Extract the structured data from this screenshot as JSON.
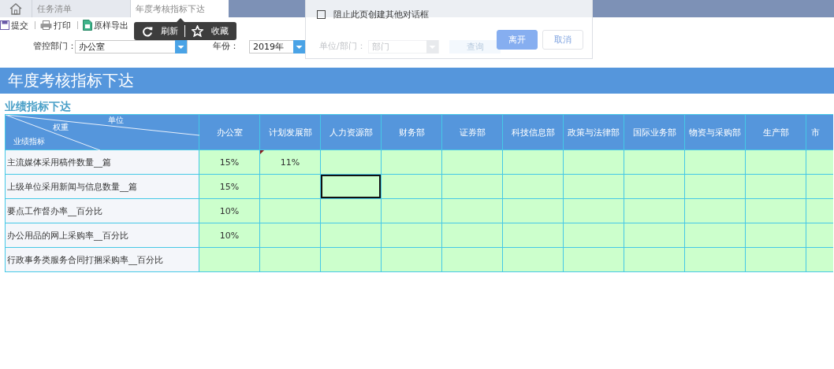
{
  "tabs": [
    {
      "kind": "home",
      "selected": false
    },
    {
      "kind": "text",
      "label": "任务清单",
      "selected": false
    },
    {
      "kind": "text",
      "label": "年度考核指标下达",
      "selected": true
    }
  ],
  "toolbar": [
    {
      "kind": "save",
      "label": "提交"
    },
    {
      "kind": "print",
      "label": "打印"
    },
    {
      "kind": "export",
      "label": "原样导出"
    }
  ],
  "popup": [
    {
      "kind": "refresh",
      "label": "刷新"
    },
    {
      "kind": "star",
      "label": "收藏"
    }
  ],
  "filters": [
    {
      "kind": "select",
      "label": "管控部门：",
      "value": "办公室",
      "disabled": false
    },
    {
      "kind": "select",
      "label": "年份：",
      "value": "2019年",
      "disabled": false
    },
    {
      "kind": "select",
      "label": "单位/部门：",
      "placeholder": "部门",
      "disabled": true
    },
    {
      "kind": "button",
      "label": "查询",
      "disabled": true
    }
  ],
  "dialog": {
    "checkbox": {
      "label": "阻止此页创建其他对话框",
      "checked": false
    },
    "buttons": [
      {
        "label": "离开",
        "primary": true
      },
      {
        "label": "取消",
        "primary": false
      }
    ]
  },
  "banner": {
    "title": "年度考核指标下达"
  },
  "section_title": "业绩指标下达",
  "table": {
    "corner": {
      "top": "单位",
      "middle": "权重",
      "bottom": "业绩指标"
    },
    "columns": [
      "办公室",
      "计划发展部",
      "人力资源部",
      "财务部",
      "证券部",
      "科技信息部",
      "政策与法律部",
      "国际业务部",
      "物资与采购部",
      "生产部",
      "市"
    ],
    "rows": [
      {
        "label": "主流媒体采用稿件数量__篇",
        "cells": [
          {
            "value": "15%",
            "selected": false,
            "note": false
          },
          {
            "value": "11%",
            "selected": false,
            "note": true
          },
          {
            "selected": false,
            "note": false
          },
          {
            "selected": false,
            "note": false
          },
          {
            "selected": false,
            "note": false
          },
          {
            "selected": false,
            "note": false
          },
          {
            "selected": false,
            "note": false
          },
          {
            "selected": false,
            "note": false
          },
          {
            "selected": false,
            "note": false
          },
          {
            "selected": false,
            "note": false
          },
          {
            "selected": false,
            "note": false
          }
        ]
      },
      {
        "label": "上级单位采用新闻与信息数量__篇",
        "cells": [
          {
            "value": "15%",
            "selected": false,
            "note": false
          },
          {
            "selected": false,
            "note": false
          },
          {
            "selected": true,
            "note": false
          },
          {
            "selected": false,
            "note": false
          },
          {
            "selected": false,
            "note": false
          },
          {
            "selected": false,
            "note": false
          },
          {
            "selected": false,
            "note": false
          },
          {
            "selected": false,
            "note": false
          },
          {
            "selected": false,
            "note": false
          },
          {
            "selected": false,
            "note": false
          },
          {
            "selected": false,
            "note": false
          }
        ]
      },
      {
        "label": "要点工作督办率__百分比",
        "cells": [
          {
            "value": "10%",
            "selected": false,
            "note": false
          },
          {
            "selected": false,
            "note": false
          },
          {
            "selected": false,
            "note": false
          },
          {
            "selected": false,
            "note": false
          },
          {
            "selected": false,
            "note": false
          },
          {
            "selected": false,
            "note": false
          },
          {
            "selected": false,
            "note": false
          },
          {
            "selected": false,
            "note": false
          },
          {
            "selected": false,
            "note": false
          },
          {
            "selected": false,
            "note": false
          },
          {
            "selected": false,
            "note": false
          }
        ]
      },
      {
        "label": "办公用品的网上采购率__百分比",
        "cells": [
          {
            "value": "10%",
            "selected": false,
            "note": false
          },
          {
            "selected": false,
            "note": false
          },
          {
            "selected": false,
            "note": false
          },
          {
            "selected": false,
            "note": false
          },
          {
            "selected": false,
            "note": false
          },
          {
            "selected": false,
            "note": false
          },
          {
            "selected": false,
            "note": false
          },
          {
            "selected": false,
            "note": false
          },
          {
            "selected": false,
            "note": false
          },
          {
            "selected": false,
            "note": false
          },
          {
            "selected": false,
            "note": false
          }
        ]
      },
      {
        "label": "行政事务类服务合同打捆采购率__百分比",
        "cells": [
          {
            "selected": false,
            "note": false
          },
          {
            "selected": false,
            "note": false
          },
          {
            "selected": false,
            "note": false
          },
          {
            "selected": false,
            "note": false
          },
          {
            "selected": false,
            "note": false
          },
          {
            "selected": false,
            "note": false
          },
          {
            "selected": false,
            "note": false
          },
          {
            "selected": false,
            "note": false
          },
          {
            "selected": false,
            "note": false
          },
          {
            "selected": false,
            "note": false
          },
          {
            "selected": false,
            "note": false
          }
        ]
      }
    ]
  }
}
